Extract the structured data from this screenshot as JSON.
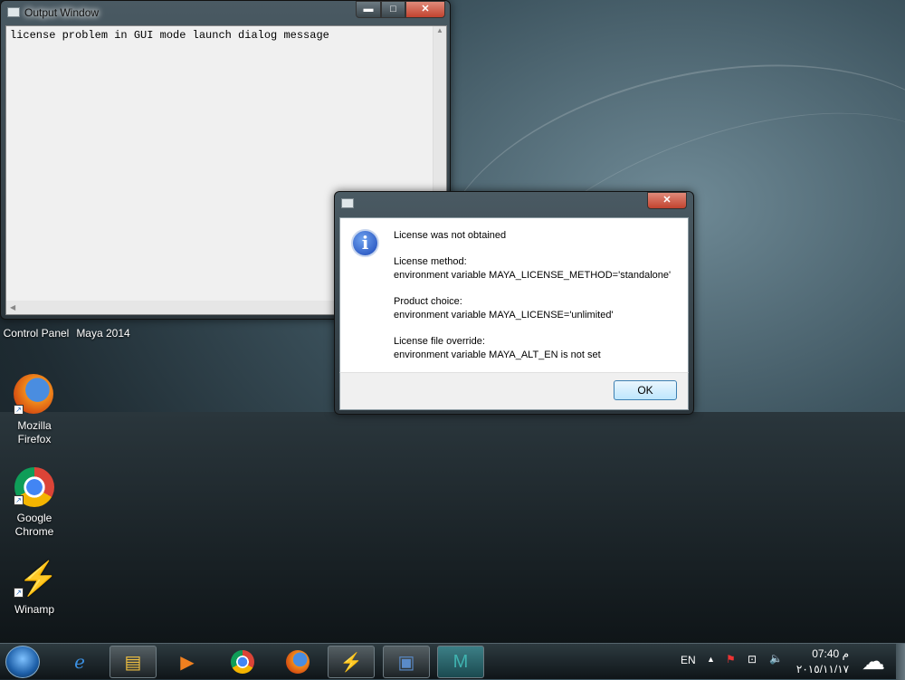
{
  "output_window": {
    "title": "Output Window",
    "text": "license problem in GUI mode launch dialog message",
    "minimize": "▬",
    "maximize": "□",
    "close": "✕"
  },
  "desktop": {
    "behind_labels": [
      "Control Panel",
      "Maya 2014"
    ],
    "icons": [
      {
        "label": "Mozilla Firefox",
        "line1": "Mozilla",
        "line2": "Firefox"
      },
      {
        "label": "Google Chrome",
        "line1": "Google",
        "line2": "Chrome"
      },
      {
        "label": "Winamp",
        "line1": "Winamp"
      }
    ]
  },
  "dialog": {
    "close": "✕",
    "heading": "License was not obtained",
    "method_label": "License method:",
    "method_value": "environment variable MAYA_LICENSE_METHOD='standalone'",
    "product_label": "Product choice:",
    "product_value": "environment variable MAYA_LICENSE='unlimited'",
    "override_label": "License file override:",
    "override_value": "environment variable MAYA_ALT_EN is not set",
    "ok": "OK"
  },
  "taskbar": {
    "items": [
      "Internet Explorer",
      "Windows Explorer",
      "Media Player",
      "Google Chrome",
      "Mozilla Firefox",
      "Winamp",
      "Output Window",
      "Maya"
    ],
    "lang": "EN",
    "time": "07:40 م",
    "date": "٢٠١٥/١١/١٧"
  }
}
